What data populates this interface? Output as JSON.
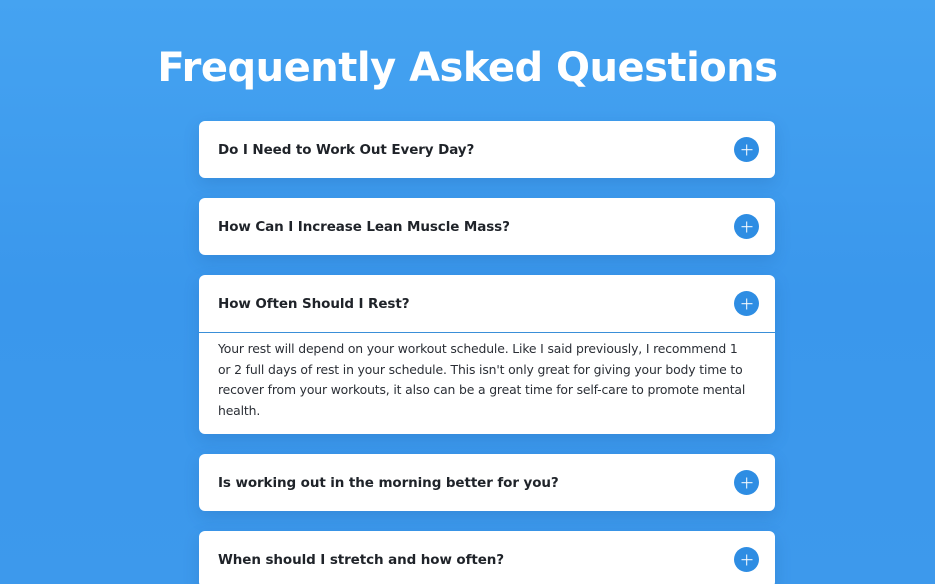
{
  "page": {
    "title": "Frequently Asked Questions"
  },
  "colors": {
    "background": "#3d9aec",
    "accent": "#2e8de3",
    "card": "#ffffff"
  },
  "faq": {
    "items": [
      {
        "question": "Do I Need to Work Out Every Day?",
        "expanded": false,
        "icon": "plus-icon"
      },
      {
        "question": "How Can I Increase Lean Muscle Mass?",
        "expanded": false,
        "icon": "plus-icon"
      },
      {
        "question": "How Often Should I Rest?",
        "expanded": true,
        "icon": "plus-icon",
        "answer": "Your rest will depend on your workout schedule. Like I said previously, I recommend 1 or 2 full days of rest in your schedule. This isn't only great for giving your body time to recover from your workouts, it also can be a great time for self-care to promote mental health."
      },
      {
        "question": "Is working out in the morning better for you?",
        "expanded": false,
        "icon": "plus-icon"
      },
      {
        "question": "When should I stretch and how often?",
        "expanded": false,
        "icon": "plus-icon"
      }
    ]
  }
}
